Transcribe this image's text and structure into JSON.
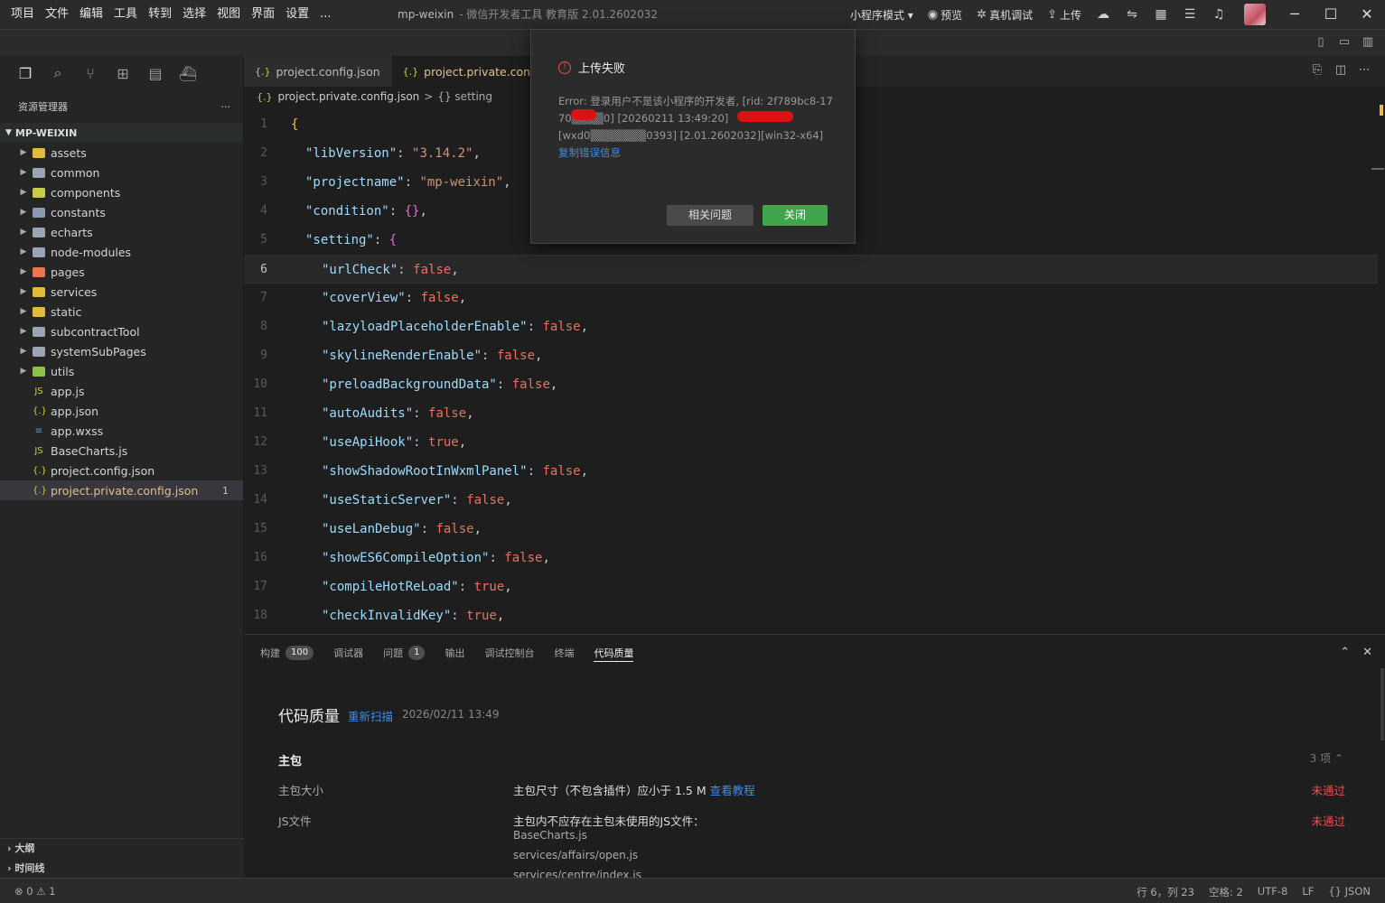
{
  "menu": [
    "项目",
    "文件",
    "编辑",
    "工具",
    "转到",
    "选择",
    "视图",
    "界面",
    "设置",
    "..."
  ],
  "window": {
    "title": "mp-weixin",
    "subtitle": "- 微信开发者工具 教育版 2.01.2602032"
  },
  "toolbar": {
    "mode": "小程序模式 ▾",
    "preview": "预览",
    "real_debug": "真机调试",
    "upload": "上传"
  },
  "sidebar": {
    "explorer_title": "资源管理器",
    "more": "···",
    "project": "MP-WEIXIN",
    "folders": [
      {
        "name": "assets",
        "color": "#e2b93d"
      },
      {
        "name": "common",
        "color": "#9aa4b4"
      },
      {
        "name": "components",
        "color": "#c9c94a"
      },
      {
        "name": "constants",
        "color": "#8a9ab0"
      },
      {
        "name": "echarts",
        "color": "#9aa4b4"
      },
      {
        "name": "node-modules",
        "color": "#9aa4b4"
      },
      {
        "name": "pages",
        "color": "#e8764a"
      },
      {
        "name": "services",
        "color": "#e2b93d"
      },
      {
        "name": "static",
        "color": "#e2b93d"
      },
      {
        "name": "subcontractTool",
        "color": "#9aa4b4"
      },
      {
        "name": "systemSubPages",
        "color": "#9aa4b4"
      },
      {
        "name": "utils",
        "color": "#8bc34a"
      }
    ],
    "files": [
      {
        "name": "app.js",
        "icon": "JS",
        "color": "#cbcb41"
      },
      {
        "name": "app.json",
        "icon": "{.}",
        "color": "#cbcb41"
      },
      {
        "name": "app.wxss",
        "icon": "≡",
        "color": "#519aba"
      },
      {
        "name": "BaseCharts.js",
        "icon": "JS",
        "color": "#cbcb41"
      },
      {
        "name": "project.config.json",
        "icon": "{.}",
        "color": "#cbcb41"
      },
      {
        "name": "project.private.config.json",
        "icon": "{.}",
        "color": "#cbcb41",
        "badge": "1"
      }
    ],
    "outline": "大纲",
    "timeline": "时间线"
  },
  "editor": {
    "tabs": [
      "project.config.json",
      "project.private.config.json"
    ],
    "breadcrumb": {
      "file": "project.private.config.json",
      "sep": ">",
      "node": "{} setting"
    },
    "lines": [
      {
        "n": "1",
        "text": "{"
      },
      {
        "n": "2",
        "key": "\"libVersion\"",
        "value": "\"3.14.2\"",
        "type": "s",
        "indent": 1
      },
      {
        "n": "3",
        "key": "\"projectname\"",
        "value": "\"mp-weixin\"",
        "type": "s",
        "indent": 1
      },
      {
        "n": "4",
        "key": "\"condition\"",
        "value": "{}",
        "type": "obj",
        "indent": 1
      },
      {
        "n": "5",
        "key": "\"setting\"",
        "value": "{",
        "type": "open",
        "indent": 1
      },
      {
        "n": "6",
        "key": "\"urlCheck\"",
        "value": "false",
        "type": "b",
        "indent": 2
      },
      {
        "n": "7",
        "key": "\"coverView\"",
        "value": "false",
        "type": "b",
        "indent": 2
      },
      {
        "n": "8",
        "key": "\"lazyloadPlaceholderEnable\"",
        "value": "false",
        "type": "b",
        "indent": 2
      },
      {
        "n": "9",
        "key": "\"skylineRenderEnable\"",
        "value": "false",
        "type": "b",
        "indent": 2
      },
      {
        "n": "10",
        "key": "\"preloadBackgroundData\"",
        "value": "false",
        "type": "b",
        "indent": 2
      },
      {
        "n": "11",
        "key": "\"autoAudits\"",
        "value": "false",
        "type": "b",
        "indent": 2
      },
      {
        "n": "12",
        "key": "\"useApiHook\"",
        "value": "true",
        "type": "b",
        "indent": 2
      },
      {
        "n": "13",
        "key": "\"showShadowRootInWxmlPanel\"",
        "value": "false",
        "type": "b",
        "indent": 2
      },
      {
        "n": "14",
        "key": "\"useStaticServer\"",
        "value": "false",
        "type": "b",
        "indent": 2
      },
      {
        "n": "15",
        "key": "\"useLanDebug\"",
        "value": "false",
        "type": "b",
        "indent": 2
      },
      {
        "n": "16",
        "key": "\"showES6CompileOption\"",
        "value": "false",
        "type": "b",
        "indent": 2
      },
      {
        "n": "17",
        "key": "\"compileHotReLoad\"",
        "value": "true",
        "type": "b",
        "indent": 2
      },
      {
        "n": "18",
        "key": "\"checkInvalidKey\"",
        "value": "true",
        "type": "b",
        "indent": 2
      }
    ]
  },
  "panel": {
    "tabs": [
      {
        "label": "构建",
        "badge": "100"
      },
      {
        "label": "调试器"
      },
      {
        "label": "问题",
        "badge": "1"
      },
      {
        "label": "输出"
      },
      {
        "label": "调试控制台"
      },
      {
        "label": "终端"
      },
      {
        "label": "代码质量",
        "active": true
      }
    ],
    "title": "代码质量",
    "rescan": "重新扫描",
    "time": "2026/02/11 13:49",
    "section": "主包",
    "count": "3 项 ⌃",
    "rows": [
      {
        "label": "主包大小",
        "desc": "主包尺寸（不包含插件）应小于 1.5 M",
        "link": "查看教程",
        "status": "未通过"
      },
      {
        "label": "JS文件",
        "desc": "主包内不应存在主包未使用的JS文件：",
        "status": "未通过",
        "files": [
          "BaseCharts.js",
          "services/affairs/open.js",
          "services/centre/index.js"
        ]
      }
    ]
  },
  "status": {
    "left": "⊗ 0 ⚠ 1",
    "pos": "行 6，列 23",
    "spaces": "空格: 2",
    "enc": "UTF-8",
    "eol": "LF",
    "lang": "{} JSON"
  },
  "dialog": {
    "title": "上传失败",
    "message": "Error: 登录用户不是该小程序的开发者, [rid: 2f789bc8-17 70▒▒▒▒0] [20260211 13:49:20][wxd0▒▒▒▒▒▒▒0393] [2.01.2602032][win32-x64]",
    "copy": "复制错误信息",
    "btn_related": "相关问题",
    "btn_close": "关闭"
  }
}
